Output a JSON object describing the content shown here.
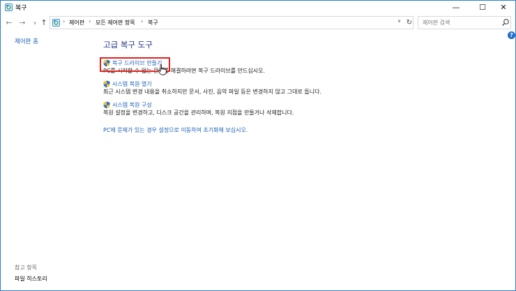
{
  "window": {
    "title": "복구",
    "controls": {
      "minimize": "—",
      "maximize": "☐",
      "close": "✕"
    }
  },
  "nav": {
    "back": "←",
    "forward": "→",
    "recent": "∨",
    "up": "↑"
  },
  "address": {
    "breadcrumbs": [
      "제어판",
      "모든 제어판 항목",
      "복구"
    ],
    "separator": "›",
    "dropdown": "∨",
    "refresh": "↻"
  },
  "search": {
    "placeholder": "제어판 검색"
  },
  "sidebar": {
    "home_label": "제어판 홈",
    "see_also_heading": "참고 항목",
    "file_history_label": "파일 히스토리"
  },
  "help": {
    "label": "?"
  },
  "main": {
    "title": "고급 복구 도구",
    "items": [
      {
        "link": "복구 드라이브 만들기",
        "description": "PC를 시작할 수 없는 문제를 해결하려면 복구 드라이브를 만드십시오."
      },
      {
        "link": "시스템 복원 열기",
        "description": "최근 시스템 변경 내용을 취소하지만 문서, 사진, 음악 파일 등은 변경하지 않고 그대로 둡니다."
      },
      {
        "link": "시스템 복원 구성",
        "description": "복원 설정을 변경하고, 디스크 공간을 관리하며, 복원 지점을 만들거나 삭제합니다."
      }
    ],
    "reset_link": "PC에 문제가 있는 경우 설정으로 이동하여 초기화해 보십시오."
  },
  "colors": {
    "link": "#1a5fb4",
    "title": "#1e3287",
    "highlight": "#e0201b",
    "window_border": "#2b7cd3"
  }
}
